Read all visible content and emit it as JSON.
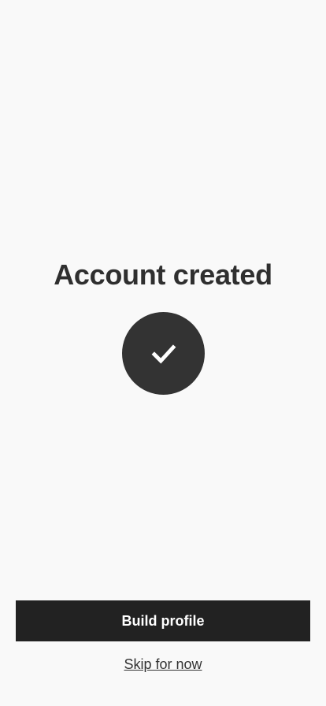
{
  "screen": {
    "title": "Account created",
    "status_icon": "checkmark-icon"
  },
  "actions": {
    "primary_label": "Build profile",
    "secondary_label": "Skip for now"
  },
  "colors": {
    "background": "#f9f9f9",
    "text": "#333333",
    "primary_button": "#222222",
    "primary_button_text": "#ffffff",
    "icon_circle": "#333333"
  }
}
